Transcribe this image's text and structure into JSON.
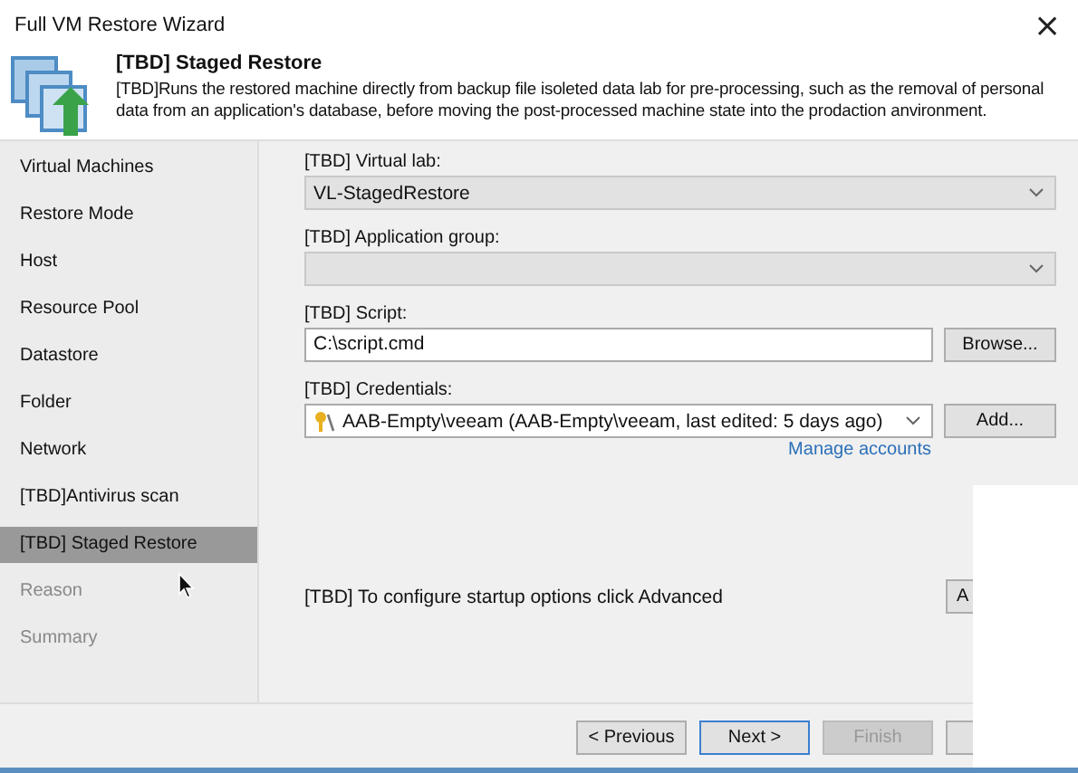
{
  "window": {
    "title": "Full VM Restore Wizard",
    "close": "×"
  },
  "header": {
    "title": "[TBD] Staged Restore",
    "description": "[TBD]Runs the restored machine directly from backup  file isoleted data lab for pre-processing, such as the removal of personal data from an application's database, before moving the post-processed machine state into the prodaction anvironment."
  },
  "steps": [
    {
      "label": "Virtual Machines",
      "selected": false,
      "disabled": false
    },
    {
      "label": "Restore Mode",
      "selected": false,
      "disabled": false
    },
    {
      "label": "Host",
      "selected": false,
      "disabled": false
    },
    {
      "label": "Resource Pool",
      "selected": false,
      "disabled": false
    },
    {
      "label": "Datastore",
      "selected": false,
      "disabled": false
    },
    {
      "label": "Folder",
      "selected": false,
      "disabled": false
    },
    {
      "label": "Network",
      "selected": false,
      "disabled": false
    },
    {
      "label": "[TBD]Antivirus scan",
      "selected": false,
      "disabled": false
    },
    {
      "label": "[TBD] Staged Restore",
      "selected": true,
      "disabled": false
    },
    {
      "label": "Reason",
      "selected": false,
      "disabled": true
    },
    {
      "label": "Summary",
      "selected": false,
      "disabled": true
    }
  ],
  "fields": [
    {
      "kind": "combo",
      "label": "[TBD] Virtual lab:",
      "value": "VL-StagedRestore"
    },
    {
      "kind": "combo",
      "label": "[TBD] Application group:"
    },
    {
      "kind": "text",
      "label": "[TBD] Script:",
      "value": "C:\\script.cmd",
      "button": "Browse..."
    },
    {
      "kind": "credentials",
      "label": "[TBD] Credentials:",
      "value": "AAB-Empty\\veeam (AAB-Empty\\veeam, last edited: 5 days ago)",
      "button": "Add...",
      "link": "Manage accounts"
    }
  ],
  "advanced": {
    "text": "[TBD] To configure startup options click Advanced",
    "button": "A"
  },
  "buttons": [
    {
      "label": "< Previous",
      "disabled": false,
      "default": false
    },
    {
      "label": "Next >",
      "disabled": false,
      "default": true
    },
    {
      "label": "Finish",
      "disabled": true,
      "default": false
    },
    {
      "disabled": false,
      "default": false
    }
  ]
}
